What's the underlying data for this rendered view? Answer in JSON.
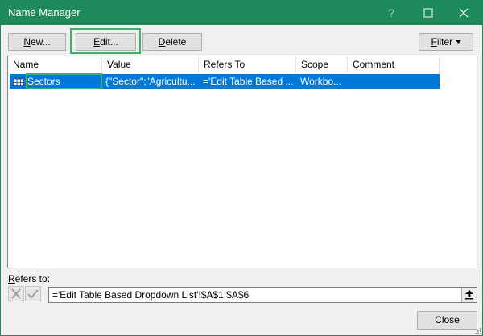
{
  "window": {
    "title": "Name Manager",
    "title_bar_color": "#1e8a5a",
    "highlight_color": "#3fae6a",
    "selection_color": "#0078d7"
  },
  "toolbar": {
    "new_label": "New...",
    "new_accel": "N",
    "new_rest": "ew...",
    "edit_label": "Edit...",
    "edit_accel": "E",
    "edit_rest": "dit...",
    "delete_label": "Delete",
    "delete_accel": "D",
    "delete_rest": "elete",
    "filter_label": "Filter",
    "filter_accel": "F",
    "filter_rest": "ilter"
  },
  "table": {
    "columns": [
      "Name",
      "Value",
      "Refers To",
      "Scope",
      "Comment"
    ],
    "rows": [
      {
        "name": "Sectors",
        "value": "{\"Sector\";\"Agricultu...",
        "refers_to": "='Edit Table Based ...",
        "scope": "Workbo...",
        "comment": "",
        "icon": "table-icon",
        "selected": true
      }
    ]
  },
  "refers": {
    "label": "Refers to:",
    "label_accel": "R",
    "label_rest": "efers to:",
    "value": "='Edit Table Based Dropdown List'!$A$1:$A$6"
  },
  "footer": {
    "close_label": "Close"
  },
  "icons": {
    "help": "help-icon",
    "maximize": "maximize-icon",
    "close": "close-icon",
    "filter_dropdown": "caret-down-icon",
    "cancel": "cancel-x-icon",
    "accept": "check-icon",
    "collapse": "collapse-up-icon",
    "resize": "resize-grip-icon"
  }
}
